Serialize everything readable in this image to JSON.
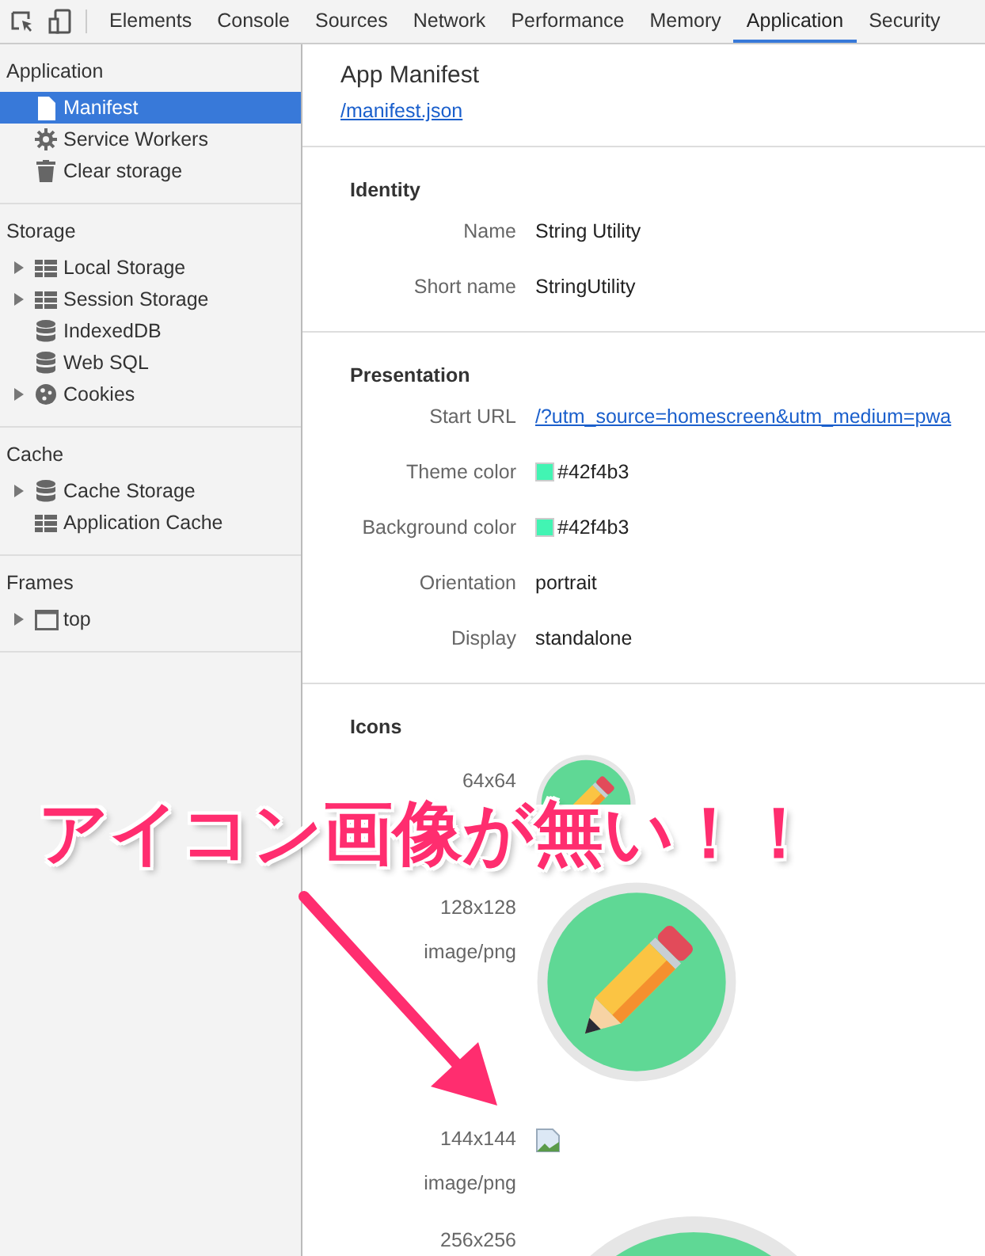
{
  "toolbar": {
    "tabs": [
      {
        "label": "Elements",
        "selected": false
      },
      {
        "label": "Console",
        "selected": false
      },
      {
        "label": "Sources",
        "selected": false
      },
      {
        "label": "Network",
        "selected": false
      },
      {
        "label": "Performance",
        "selected": false
      },
      {
        "label": "Memory",
        "selected": false
      },
      {
        "label": "Application",
        "selected": true
      },
      {
        "label": "Security",
        "selected": false
      }
    ]
  },
  "sidebar": {
    "sections": [
      {
        "title": "Application",
        "items": [
          {
            "label": "Manifest",
            "kind": "file",
            "selected": true
          },
          {
            "label": "Service Workers",
            "kind": "gear",
            "selected": false
          },
          {
            "label": "Clear storage",
            "kind": "trash",
            "selected": false
          }
        ]
      },
      {
        "title": "Storage",
        "items": [
          {
            "label": "Local Storage",
            "kind": "grid",
            "expanded": false,
            "selected": false
          },
          {
            "label": "Session Storage",
            "kind": "grid",
            "expanded": false,
            "selected": false
          },
          {
            "label": "IndexedDB",
            "kind": "database",
            "selected": false
          },
          {
            "label": "Web SQL",
            "kind": "database",
            "selected": false
          },
          {
            "label": "Cookies",
            "kind": "cookie",
            "expanded": false,
            "selected": false
          }
        ]
      },
      {
        "title": "Cache",
        "items": [
          {
            "label": "Cache Storage",
            "kind": "database",
            "expanded": false,
            "selected": false
          },
          {
            "label": "Application Cache",
            "kind": "grid",
            "selected": false
          }
        ]
      },
      {
        "title": "Frames",
        "items": [
          {
            "label": "top",
            "kind": "frame",
            "expanded": false,
            "selected": false
          }
        ]
      }
    ]
  },
  "main": {
    "title": "App Manifest",
    "link": "/manifest.json",
    "sections": [
      {
        "title": "Identity",
        "rows": [
          {
            "label": "Name",
            "value": "String Utility",
            "kind": "text"
          },
          {
            "label": "Short name",
            "value": "StringUtility",
            "kind": "text"
          }
        ]
      },
      {
        "title": "Presentation",
        "rows": [
          {
            "label": "Start URL",
            "value": "/?utm_source=homescreen&utm_medium=pwa",
            "kind": "link"
          },
          {
            "label": "Theme color",
            "value": "#42f4b3",
            "kind": "color",
            "color": "#42f4b3"
          },
          {
            "label": "Background color",
            "value": "#42f4b3",
            "kind": "color",
            "color": "#42f4b3"
          },
          {
            "label": "Orientation",
            "value": "portrait",
            "kind": "text"
          },
          {
            "label": "Display",
            "value": "standalone",
            "kind": "text"
          }
        ]
      }
    ],
    "icons": {
      "title": "Icons",
      "rows": [
        {
          "size": "64x64",
          "kind": "image"
        },
        {
          "size": "128x128",
          "type": "image/png",
          "kind": "image"
        },
        {
          "size": "144x144",
          "type": "image/png",
          "kind": "broken"
        },
        {
          "size": "256x256",
          "kind": "image"
        }
      ]
    }
  },
  "annotation": {
    "text": "アイコン画像が無い！！"
  }
}
